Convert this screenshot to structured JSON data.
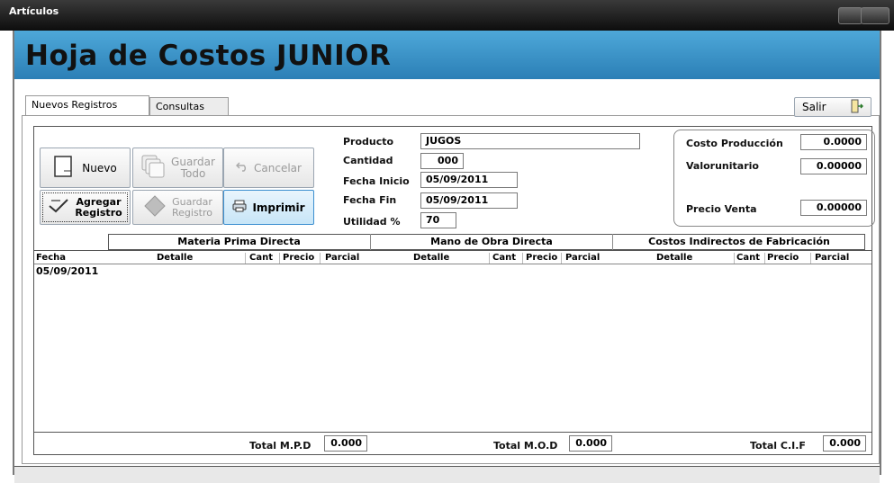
{
  "window": {
    "title": "Artículos",
    "header": "Hoja de Costos  JUNIOR"
  },
  "tabs": [
    {
      "label": "Nuevos Registros",
      "active": true
    },
    {
      "label": "Consultas",
      "active": false
    }
  ],
  "exit_button": {
    "label": "Salir",
    "icon": "exit-door-icon"
  },
  "toolbar": {
    "nuevo": "Nuevo",
    "guardar_todo_1": "Guardar",
    "guardar_todo_2": "Todo",
    "cancelar": "Cancelar",
    "agregar_1": "Agregar",
    "agregar_2": "Registro",
    "guardar_reg_1": "Guardar",
    "guardar_reg_2": "Registro",
    "imprimir": "Imprimir"
  },
  "form": {
    "producto_label": "Producto",
    "producto_value": "JUGOS",
    "cantidad_label": "Cantidad",
    "cantidad_value": "000",
    "fecha_inicio_label": "Fecha Inicio",
    "fecha_inicio_value": "05/09/2011",
    "fecha_fin_label": "Fecha Fin",
    "fecha_fin_value": "05/09/2011",
    "utilidad_label": "Utilidad %",
    "utilidad_value": "70"
  },
  "costs": {
    "costo_produccion_label": "Costo Producción",
    "costo_produccion_value": "0.0000",
    "valor_unitario_label": "Valorunitario",
    "valor_unitario_value": "0.00000",
    "precio_venta_label": "Precio Venta",
    "precio_venta_value": "0.00000"
  },
  "grid": {
    "groups": [
      "Materia Prima Directa",
      "Mano de Obra Directa",
      "Costos Indirectos de Fabricación"
    ],
    "fecha_header": "Fecha",
    "col_detalle": "Detalle",
    "col_cant": "Cant",
    "col_precio": "Precio",
    "col_parcial": "Parcial",
    "rows": [
      {
        "fecha": "05/09/2011"
      }
    ]
  },
  "totals": {
    "mpd_label": "Total M.P.D",
    "mpd_value": "0.000",
    "mod_label": "Total M.O.D",
    "mod_value": "0.000",
    "cif_label": "Total C.I.F",
    "cif_value": "0.000"
  }
}
